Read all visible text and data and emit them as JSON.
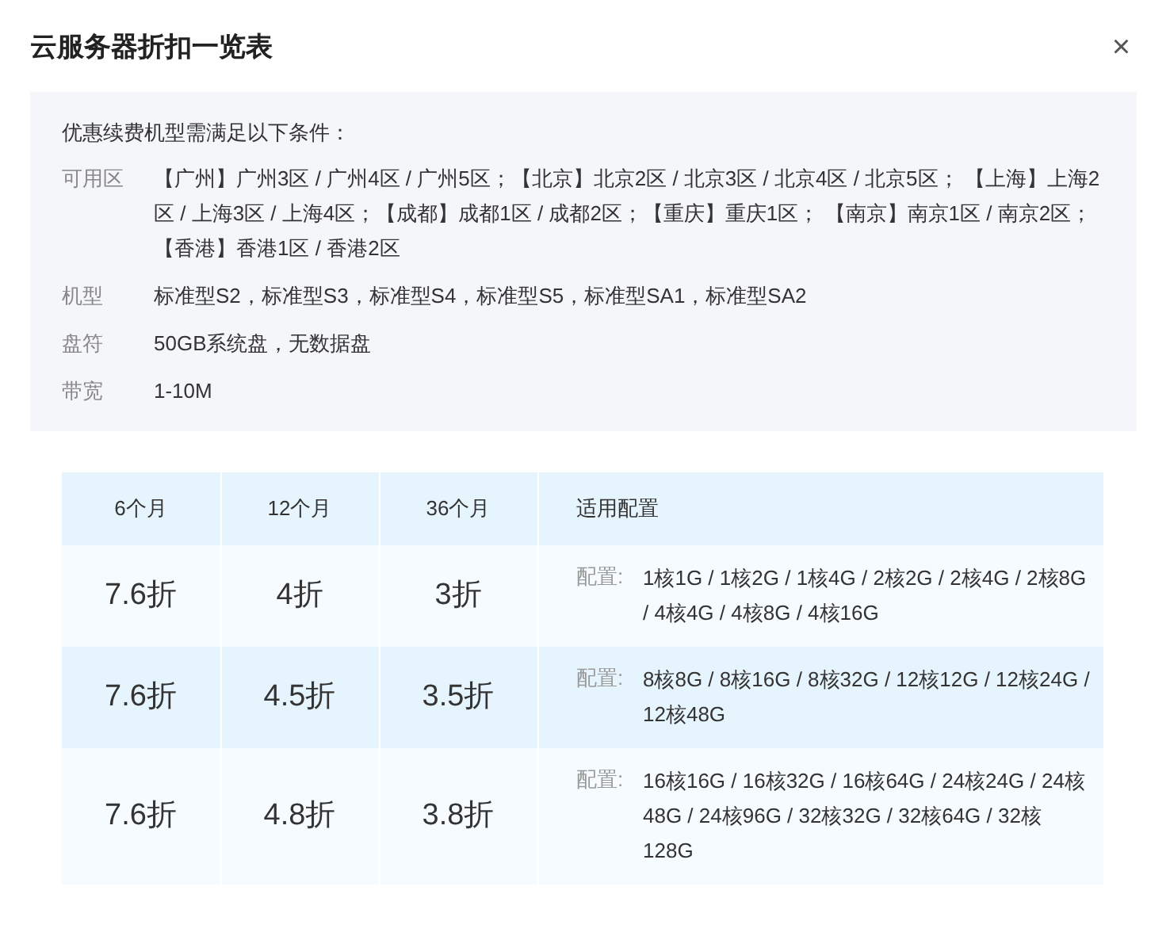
{
  "dialog": {
    "title": "云服务器折扣一览表",
    "close": "×"
  },
  "conditions": {
    "heading": "优惠续费机型需满足以下条件：",
    "items": [
      {
        "label": "可用区",
        "value": "【广州】广州3区 / 广州4区 / 广州5区；【北京】北京2区 / 北京3区 / 北京4区 / 北京5区；  【上海】上海2区 / 上海3区 / 上海4区；【成都】成都1区 / 成都2区；【重庆】重庆1区；  【南京】南京1区 / 南京2区；【香港】香港1区 / 香港2区"
      },
      {
        "label": "机型",
        "value": "标准型S2，标准型S3，标准型S4，标准型S5，标准型SA1，标准型SA2"
      },
      {
        "label": "盘符",
        "value": "50GB系统盘，无数据盘"
      },
      {
        "label": "带宽",
        "value": "1-10M"
      }
    ]
  },
  "table": {
    "columns": [
      "6个月",
      "12个月",
      "36个月",
      "适用配置"
    ],
    "rows": [
      {
        "discounts": [
          "7.6折",
          "4折",
          "3折"
        ],
        "config_label": "配置:",
        "config": "1核1G / 1核2G / 1核4G / 2核2G / 2核4G / 2核8G / 4核4G / 4核8G / 4核16G"
      },
      {
        "discounts": [
          "7.6折",
          "4.5折",
          "3.5折"
        ],
        "config_label": "配置:",
        "config": "8核8G / 8核16G / 8核32G / 12核12G / 12核24G / 12核48G"
      },
      {
        "discounts": [
          "7.6折",
          "4.8折",
          "3.8折"
        ],
        "config_label": "配置:",
        "config": "16核16G / 16核32G / 16核64G / 24核24G / 24核48G / 24核96G / 32核32G / 32核64G / 32核128G"
      }
    ]
  }
}
